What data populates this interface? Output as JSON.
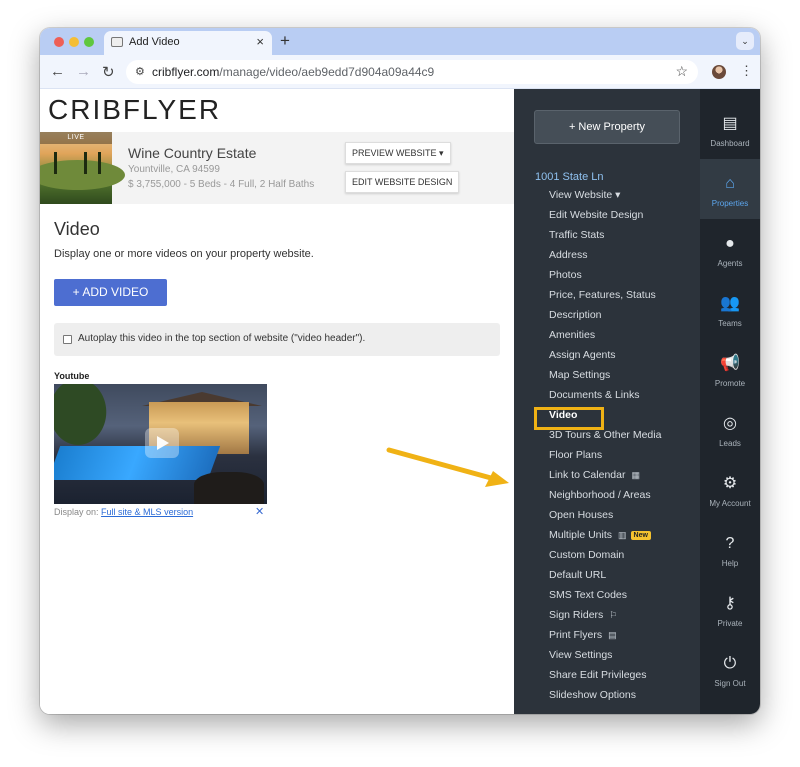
{
  "browser": {
    "tab_title": "Add Video",
    "close_glyph": "×",
    "new_tab_glyph": "+",
    "tab_menu_glyph": "⌄",
    "back_glyph": "←",
    "forward_glyph": "→",
    "reload_glyph": "↻",
    "site_info_glyph": "⚙",
    "url_host": "cribflyer.com",
    "url_path": "/manage/video/aeb9edd7d904a09a44c9",
    "bookmark_glyph": "☆",
    "menu_glyph": "⋮"
  },
  "app": {
    "logo": "CRIBFLYER"
  },
  "property": {
    "live_label": "LIVE",
    "name": "Wine Country Estate",
    "address": "Yountville, CA 94599",
    "meta": "$ 3,755,000 - 5 Beds - 4 Full, 2 Half Baths",
    "preview_button": "PREVIEW WEBSITE ▾",
    "edit_button": "EDIT WEBSITE DESIGN"
  },
  "main": {
    "title": "Video",
    "description": "Display one or more videos on your property website.",
    "add_button": "+ ADD VIDEO",
    "autoplay_label": "Autoplay this video in the top section of website (\"video header\").",
    "autoplay_checked": false,
    "video": {
      "source_label": "Youtube",
      "display_on_prefix": "Display on:",
      "display_on_link": "Full site & MLS version",
      "remove_glyph": "✕"
    }
  },
  "menu": {
    "new_property_button": "+ New Property",
    "property_heading": "1001 State Ln",
    "items": [
      {
        "label": "View Website ▾"
      },
      {
        "label": "Edit Website Design"
      },
      {
        "label": "Traffic Stats"
      },
      {
        "label": "Address"
      },
      {
        "label": "Photos"
      },
      {
        "label": "Price, Features, Status"
      },
      {
        "label": "Description"
      },
      {
        "label": "Amenities"
      },
      {
        "label": "Assign Agents"
      },
      {
        "label": "Map Settings"
      },
      {
        "label": "Documents & Links"
      },
      {
        "label": "Video",
        "active": true
      },
      {
        "label": "3D Tours & Other Media"
      },
      {
        "label": "Floor Plans"
      },
      {
        "label": "Link to Calendar",
        "icon": "▦"
      },
      {
        "label": "Neighborhood / Areas"
      },
      {
        "label": "Open Houses"
      },
      {
        "label": "Multiple Units",
        "icon": "▥",
        "badge": "New"
      },
      {
        "label": "Custom Domain"
      },
      {
        "label": "Default URL"
      },
      {
        "label": "SMS Text Codes"
      },
      {
        "label": "Sign Riders",
        "icon": "⚐"
      },
      {
        "label": "Print Flyers",
        "icon": "▤"
      },
      {
        "label": "View Settings"
      },
      {
        "label": "Share Edit Privileges"
      },
      {
        "label": "Slideshow Options"
      }
    ]
  },
  "sidebar": {
    "items": [
      {
        "label": "Dashboard",
        "icon": "dashboard-icon",
        "glyph": "▤"
      },
      {
        "label": "Properties",
        "icon": "properties-icon",
        "glyph": "⌂",
        "selected": true
      },
      {
        "label": "Agents",
        "icon": "agent-icon",
        "glyph": "●"
      },
      {
        "label": "Teams",
        "icon": "teams-icon",
        "glyph": "👥"
      },
      {
        "label": "Promote",
        "icon": "megaphone-icon",
        "glyph": "📢"
      },
      {
        "label": "Leads",
        "icon": "target-icon",
        "glyph": "◎"
      },
      {
        "label": "My Account",
        "icon": "gear-icon",
        "glyph": "⚙"
      },
      {
        "label": "Help",
        "icon": "help-icon",
        "glyph": "?"
      },
      {
        "label": "Private",
        "icon": "key-icon",
        "glyph": "⚷"
      },
      {
        "label": "Sign Out",
        "icon": "power-icon",
        "glyph": "⏻"
      }
    ]
  },
  "colors": {
    "accent_button": "#4d6ed1",
    "menu_bg": "#2c333b",
    "sidebar_bg": "#1f252c",
    "highlight": "#f0b215",
    "link": "#2b6bd6"
  }
}
